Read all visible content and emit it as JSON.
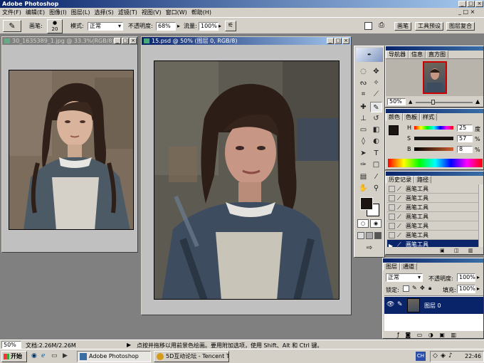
{
  "app": {
    "title": "Adobe Photoshop"
  },
  "menu": [
    "文件(F)",
    "编辑(E)",
    "图像(I)",
    "图层(L)",
    "选择(S)",
    "滤镜(T)",
    "视图(V)",
    "窗口(W)",
    "帮助(H)"
  ],
  "options": {
    "brush_label": "画笔:",
    "brush_size": "20",
    "mode_label": "模式:",
    "mode_value": "正常",
    "opacity_label": "不透明度:",
    "opacity_value": "68%",
    "flow_label": "流量:",
    "flow_value": "100%",
    "tabs": [
      "画笔",
      "工具预设",
      "图层复合"
    ]
  },
  "docs": {
    "doc1_title": "30_1635389_1.jpg @ 33.3%(RGB/8)",
    "doc2_title": "15.psd @ 50% (图层 0, RGB/8)"
  },
  "navigator": {
    "tabs": [
      "导航器",
      "信息",
      "直方图"
    ],
    "zoom": "50%"
  },
  "color": {
    "tabs": [
      "颜色",
      "色板",
      "样式"
    ],
    "h_label": "H",
    "h_value": "25",
    "h_unit": "度",
    "s_label": "S",
    "s_value": "57",
    "s_unit": "%",
    "b_label": "B",
    "b_value": "8",
    "b_unit": "%"
  },
  "history": {
    "tabs": [
      "历史记录",
      "路径"
    ],
    "items": [
      "画笔工具",
      "画笔工具",
      "画笔工具",
      "画笔工具",
      "画笔工具",
      "画笔工具",
      "画笔工具"
    ]
  },
  "layers": {
    "tabs": [
      "图层",
      "通道"
    ],
    "blend_mode": "正常",
    "opacity_label": "不透明度:",
    "opacity_value": "100%",
    "lock_label": "锁定:",
    "fill_label": "填充:",
    "fill_value": "100%",
    "layer_name": "图层 0"
  },
  "status": {
    "zoom": "50%",
    "doc_size": "文档:2.26M/2.26M",
    "hint": "点按并拖移以用前景色绘画。要用附加选项，使用 Shift、Alt 和 Ctrl 键。"
  },
  "taskbar": {
    "start": "开始",
    "tasks": [
      "Adobe Photoshop",
      "5D互动论坛 - Tencent T..."
    ],
    "lang": "CH",
    "clock": "22:46"
  },
  "colors": {
    "accent": "#0a246a",
    "chrome": "#d4d0c8",
    "workspace": "#808080"
  }
}
